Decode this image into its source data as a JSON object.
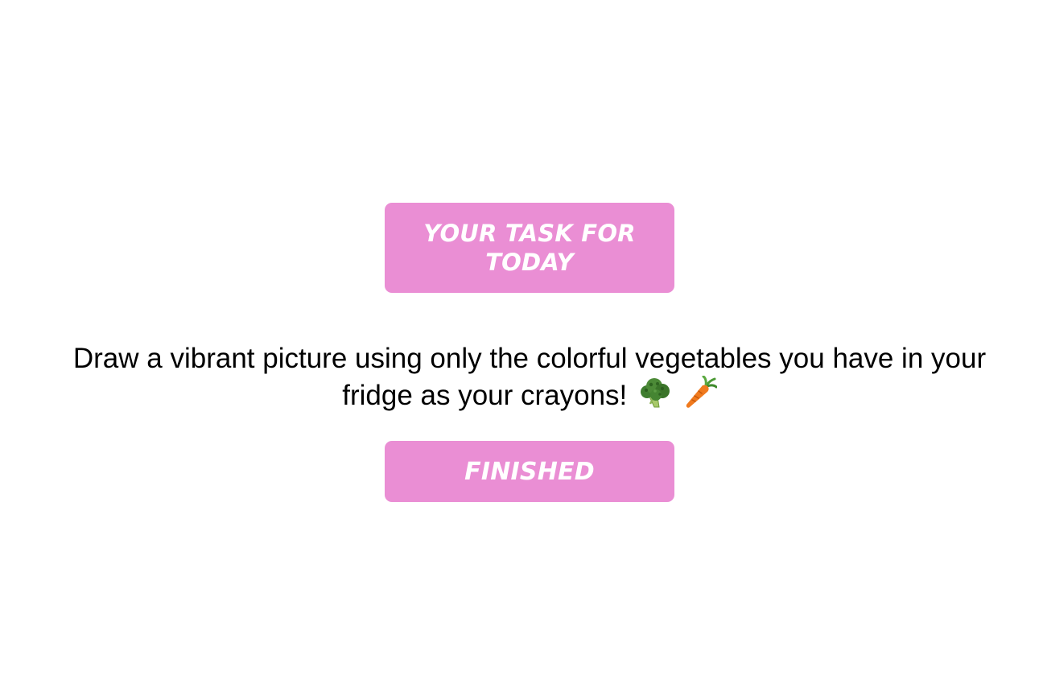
{
  "task_card": {
    "title": "YOUR TASK FOR TODAY",
    "description": "Draw a vibrant picture using only the colorful vegetables you have in your fridge as your crayons!",
    "emoji_icons": [
      "broccoli-icon",
      "carrot-icon"
    ],
    "finished_label": "FINISHED"
  },
  "colors": {
    "accent": "#ea8ed4",
    "button_text": "#ffffff",
    "body_text": "#000000",
    "background": "#ffffff"
  }
}
